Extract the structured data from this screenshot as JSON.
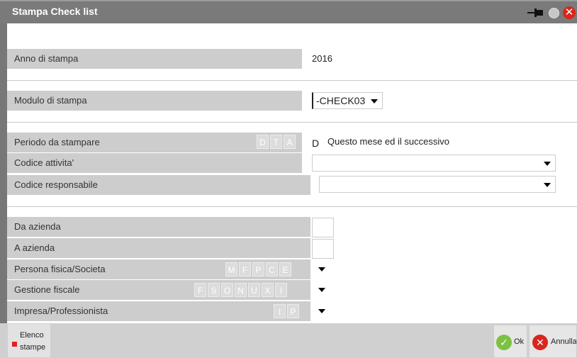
{
  "window": {
    "title": "Stampa Check list"
  },
  "fields": {
    "anno": {
      "label": "Anno di stampa",
      "value": "2016"
    },
    "modulo": {
      "label": "Modulo di stampa",
      "value": "-CHECK03"
    },
    "periodo": {
      "label": "Periodo da stampare",
      "chips": [
        "D",
        "T",
        "A"
      ],
      "value": "D",
      "desc": "Questo mese ed il successivo"
    },
    "attivita": {
      "label": "Codice attivita'",
      "value": ""
    },
    "responsabile": {
      "label": "Codice responsabile",
      "value": ""
    },
    "da_azienda": {
      "label": "Da azienda",
      "value": ""
    },
    "a_azienda": {
      "label": "A azienda",
      "value": ""
    },
    "persona": {
      "label": "Persona fisica/Societa",
      "chips": [
        "M",
        "F",
        "P",
        "C",
        "E"
      ]
    },
    "gestione": {
      "label": "Gestione fiscale",
      "chips": [
        "F",
        "S",
        "O",
        "N",
        "U",
        "X",
        "I"
      ]
    },
    "impresa": {
      "label": "Impresa/Professionista",
      "chips": [
        "I",
        "P"
      ]
    }
  },
  "buttons": {
    "elenco": {
      "line1": "Elenco",
      "line2": "stampe"
    },
    "ok": {
      "label": "Ok"
    },
    "annulla": {
      "label": "Annulla"
    }
  }
}
